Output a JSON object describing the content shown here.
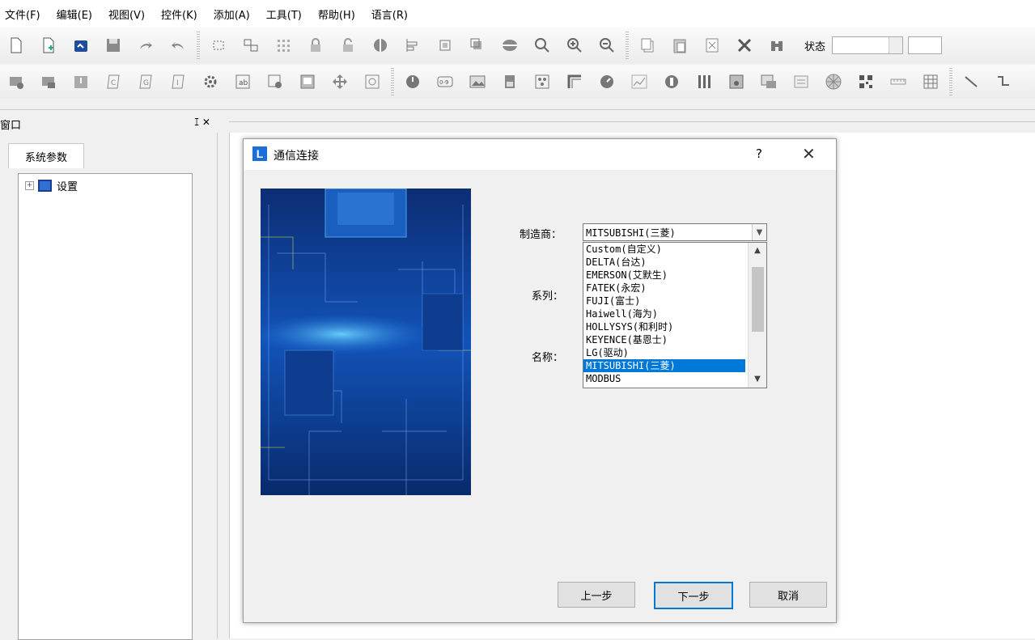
{
  "menu": [
    "文件(F)",
    "编辑(E)",
    "视图(V)",
    "控件(K)",
    "添加(A)",
    "工具(T)",
    "帮助(H)",
    "语言(R)"
  ],
  "toolbar": {
    "status_label": "状态"
  },
  "left_pane": {
    "title": "窗口",
    "controls": "ꕯ ✕",
    "tab": "系统参数",
    "tree_expander": "+",
    "tree_node": "设置"
  },
  "dialog": {
    "logo": "L",
    "title": "通信连接",
    "help": "?",
    "close": "✕",
    "manufacturer_label": "制造商：",
    "manufacturer_value": "MITSUBISHI(三菱)",
    "series_label": "系列：",
    "name_label": "名称：",
    "options": [
      "Custom(自定义)",
      "DELTA(台达)",
      "EMERSON(艾默生)",
      "FATEK(永宏)",
      "FUJI(富士)",
      "Haiwell(海为)",
      "HOLLYSYS(和利时)",
      "KEYENCE(基恩士)",
      "LG(驱动)",
      "MITSUBISHI(三菱)",
      "MODBUS"
    ],
    "selected_index": 9,
    "buttons": {
      "prev": "上一步",
      "next": "下一步",
      "cancel": "取消"
    }
  },
  "colors": {
    "selection": "#0078d7",
    "logo": "#1c6fd8"
  }
}
